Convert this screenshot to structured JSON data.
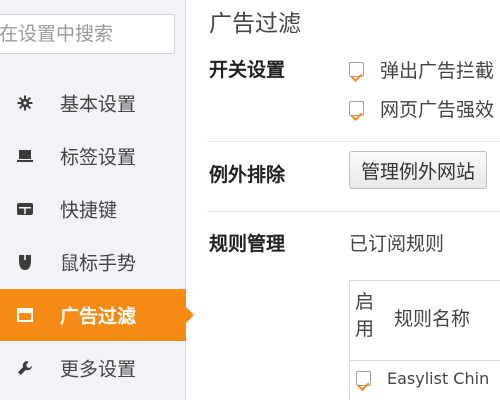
{
  "sidebar": {
    "search_placeholder": "在设置中搜索",
    "items": [
      {
        "label": "基本设置",
        "icon": "gear-icon"
      },
      {
        "label": "标签设置",
        "icon": "tab-icon"
      },
      {
        "label": "快捷键",
        "icon": "keyboard-icon"
      },
      {
        "label": "鼠标手势",
        "icon": "mouse-icon"
      },
      {
        "label": "广告过滤",
        "icon": "window-icon",
        "active": true
      },
      {
        "label": "更多设置",
        "icon": "wrench-icon"
      }
    ],
    "active_color": "#f58a14"
  },
  "main": {
    "title": "广告过滤",
    "switch_section": {
      "label": "开关设置",
      "options": [
        {
          "label": "弹出广告拦截",
          "checked": true
        },
        {
          "label": "网页广告强效",
          "checked": true
        }
      ]
    },
    "exception_section": {
      "label": "例外排除",
      "button_label": "管理例外网站"
    },
    "rules_section": {
      "label": "规则管理",
      "subscribed_label": "已订阅规则",
      "table": {
        "col_enable": "启用",
        "col_name": "规则名称",
        "rows": [
          {
            "name": "Easylist Chin",
            "enabled": true
          }
        ]
      }
    }
  }
}
